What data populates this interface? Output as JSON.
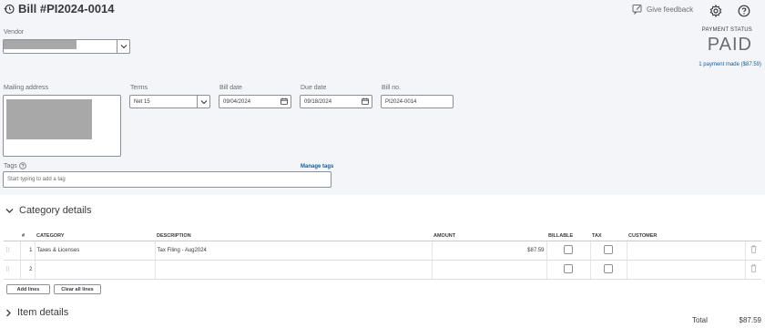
{
  "header": {
    "title": "Bill #PI2024-0014",
    "feedback_label": "Give feedback"
  },
  "payment": {
    "status_label": "PAYMENT STATUS",
    "status": "PAID",
    "payment_link": "1 payment made ($87.59)"
  },
  "form": {
    "vendor_label": "Vendor",
    "mailing_label": "Mailing address",
    "terms_label": "Terms",
    "terms_value": "Net 15",
    "bill_date_label": "Bill date",
    "bill_date_value": "09/04/2024",
    "due_date_label": "Due date",
    "due_date_value": "09/18/2024",
    "bill_no_label": "Bill no.",
    "bill_no_value": "PI2024-0014",
    "tags_label": "Tags",
    "tags_placeholder": "Start typing to add a tag",
    "manage_tags": "Manage tags"
  },
  "category": {
    "heading": "Category details",
    "columns": {
      "num": "#",
      "category": "CATEGORY",
      "description": "DESCRIPTION",
      "amount": "AMOUNT",
      "billable": "BILLABLE",
      "tax": "TAX",
      "customer": "CUSTOMER"
    },
    "rows": [
      {
        "num": "1",
        "category": "Taxes & Licenses",
        "description": "Tax Filing - Aug2024",
        "amount": "$87.59"
      },
      {
        "num": "2",
        "category": "",
        "description": "",
        "amount": ""
      }
    ],
    "add_lines": "Add lines",
    "clear_lines": "Clear all lines"
  },
  "items": {
    "heading": "Item details"
  },
  "totals": {
    "label": "Total",
    "value": "$87.59"
  },
  "colors": {
    "link": "#0d62a3",
    "text": "#393a3d",
    "background": "#f4f5f8"
  }
}
